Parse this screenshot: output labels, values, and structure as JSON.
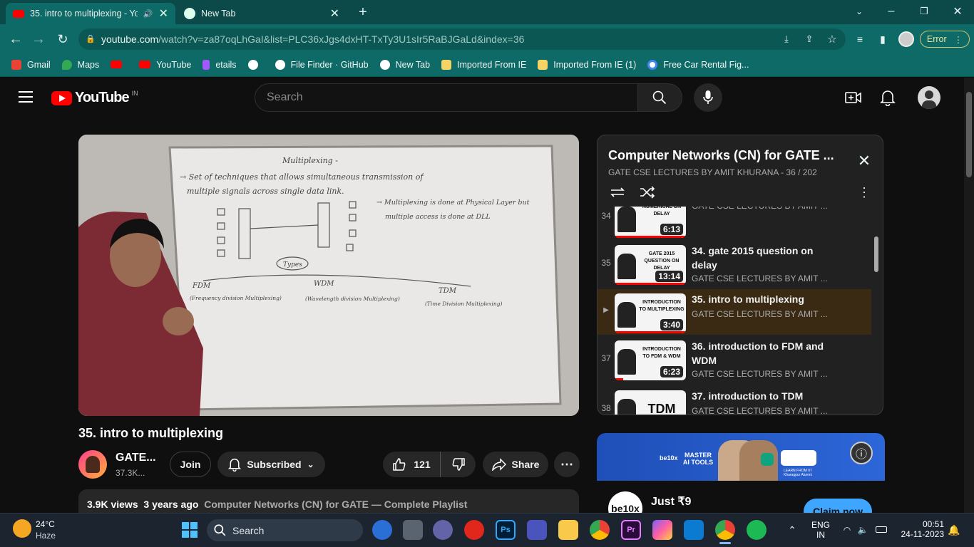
{
  "browser": {
    "tabs": [
      {
        "title": "35. intro to multiplexing - Yo",
        "active": true
      },
      {
        "title": "New Tab",
        "active": false
      }
    ],
    "url_host": "youtube.com",
    "url_path": "/watch?v=za87oqLhGaI&list=PLC36xJgs4dxHT-TxTy3U1sIr5RaBJGaLd&index=36",
    "error_label": "Error",
    "bookmarks": [
      {
        "label": "Gmail",
        "color": "#ea4335"
      },
      {
        "label": "Maps",
        "color": "#34a853"
      },
      {
        "label": "",
        "color": "#ff0000"
      },
      {
        "label": "YouTube",
        "color": "#ff0000"
      },
      {
        "label": "etails",
        "color": "#a259ff"
      },
      {
        "label": "",
        "color": "#ffffff"
      },
      {
        "label": "File Finder · GitHub",
        "color": "#ffffff"
      },
      {
        "label": "New Tab",
        "color": "#ffffff"
      },
      {
        "label": "Imported From IE",
        "color": "#f6d365"
      },
      {
        "label": "Imported From IE (1)",
        "color": "#f6d365"
      },
      {
        "label": "Free Car Rental Fig...",
        "color": "#4285f4"
      }
    ]
  },
  "youtube": {
    "logo_text": "YouTube",
    "logo_region": "IN",
    "search_placeholder": "Search"
  },
  "player": {
    "board_heading": "Multiplexing -",
    "board_line1": "→ Set of techniques that allows simultaneous transmission of",
    "board_line2": "multiple signals across single data link.",
    "board_note1": "→ Multiplexing is done at Physical Layer but",
    "board_note2": "multiple access is done at DLL",
    "board_types": "Types",
    "board_fdm": "FDM",
    "board_fdm_full": "(Frequency division Multiplexing)",
    "board_wdm": "WDM",
    "board_wdm_full": "(Wavelength division Multiplexing)",
    "board_tdm": "TDM",
    "board_tdm_full": "(Time Division Multiplexing)"
  },
  "playlist": {
    "title": "Computer Networks (CN) for GATE ...",
    "meta": "GATE CSE LECTURES BY AMIT KHURANA - 36 / 202",
    "items": [
      {
        "index": "34",
        "thumb_text": "NUMERICAL ON DELAY",
        "duration": "6:13",
        "title": "",
        "channel": "GATE CSE LECTURES BY AMIT ...",
        "current": false,
        "progress": 1.0
      },
      {
        "index": "35",
        "thumb_text": "GATE 2015 QUESTION ON DELAY",
        "duration": "13:14",
        "title": "34. gate 2015 question on delay",
        "channel": "GATE CSE LECTURES BY AMIT ...",
        "current": false,
        "progress": 1.0
      },
      {
        "index": "▶",
        "thumb_text": "INTRODUCTION TO MULTIPLEXING",
        "duration": "3:40",
        "title": "35. intro to multiplexing",
        "channel": "GATE CSE LECTURES BY AMIT ...",
        "current": true,
        "progress": 1.0
      },
      {
        "index": "37",
        "thumb_text": "INTRODUCTION TO FDM & WDM",
        "duration": "6:23",
        "title": "36. introduction to FDM and WDM",
        "channel": "GATE CSE LECTURES BY AMIT ...",
        "current": false,
        "progress": 0.12
      },
      {
        "index": "38",
        "thumb_text": "TDM",
        "duration": "16:55",
        "title": "37. introduction to TDM",
        "channel": "GATE CSE LECTURES BY AMIT ...",
        "current": false,
        "progress": 0
      }
    ]
  },
  "video": {
    "title": "35. intro to multiplexing",
    "channel_name": "GATE...",
    "subscribers": "37.3K...",
    "join_label": "Join",
    "subscribed_label": "Subscribed",
    "likes": "121",
    "share_label": "Share",
    "views": "3.9K views",
    "age": "3 years ago",
    "playlist_link": "Computer Networks (CN) for GATE — Complete Playlist"
  },
  "ad": {
    "banner_text": "MASTER AI TOOLS",
    "brand": "be10x",
    "price": "Just ₹9",
    "cta": "Claim now",
    "learn_from": "LEARN FROM IIT Kharagpur Alumni"
  },
  "taskbar": {
    "temperature": "24°C",
    "weather": "Haze",
    "search_label": "Search",
    "lang_top": "ENG",
    "lang_bottom": "IN",
    "time": "00:51",
    "date": "24-11-2023"
  }
}
